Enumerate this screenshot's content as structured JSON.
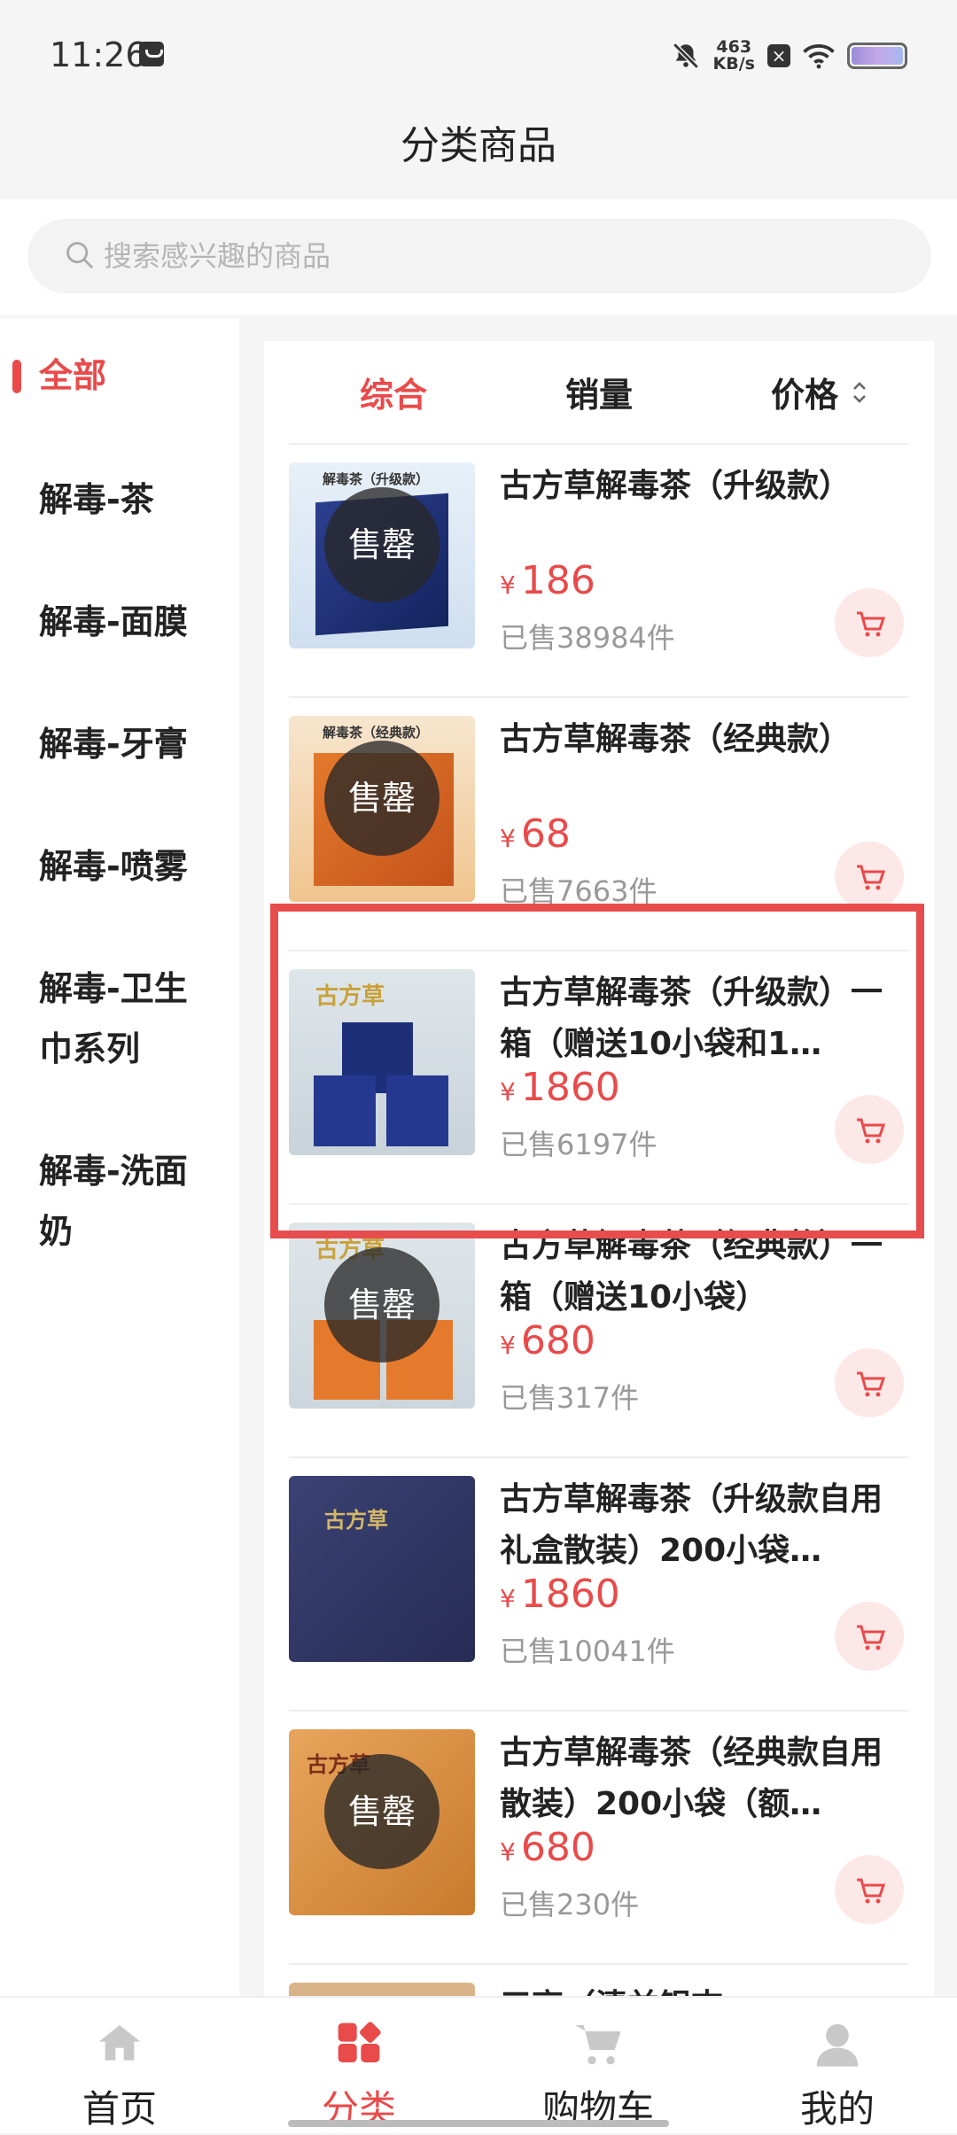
{
  "status": {
    "time": "11:26",
    "speed_value": "463",
    "speed_unit": "KB/s"
  },
  "page": {
    "title": "分类商品"
  },
  "search": {
    "placeholder": "搜索感兴趣的商品"
  },
  "sidebar": {
    "items": [
      {
        "label": "全部",
        "active": true
      },
      {
        "label": "解毒-茶"
      },
      {
        "label": "解毒-面膜"
      },
      {
        "label": "解毒-牙膏"
      },
      {
        "label": "解毒-喷雾"
      },
      {
        "label": "解毒-卫生巾系列"
      },
      {
        "label": "解毒-洗面奶"
      }
    ]
  },
  "sort": {
    "tabs": [
      {
        "label": "综合",
        "active": true
      },
      {
        "label": "销量"
      },
      {
        "label": "价格"
      }
    ]
  },
  "soldout_label": "售罄",
  "currency": "¥",
  "products": [
    {
      "title": "古方草解毒茶（升级款）",
      "price": "186",
      "sold": "已售38984件",
      "soldout": true,
      "thumb_label": "解毒茶（升级款）"
    },
    {
      "title": "古方草解毒茶（经典款）",
      "price": "68",
      "sold": "已售7663件",
      "soldout": true,
      "thumb_label": "解毒茶（经典款）"
    },
    {
      "title": "古方草解毒茶（升级款）一箱（赠送10小袋和1…",
      "price": "1860",
      "sold": "已售6197件",
      "soldout": false,
      "thumb_label": "古方草"
    },
    {
      "title": "古方草解毒茶（经典款）一箱（赠送10小袋）",
      "price": "680",
      "sold": "已售317件",
      "soldout": true,
      "thumb_label": "古方草"
    },
    {
      "title": "古方草解毒茶（升级款自用礼盒散装）200小袋…",
      "price": "1860",
      "sold": "已售10041件",
      "soldout": false,
      "thumb_label": "古方草"
    },
    {
      "title": "古方草解毒茶（经典款自用散装）200小袋（额…",
      "price": "680",
      "sold": "已售230件",
      "soldout": true,
      "thumb_label": "古方草"
    },
    {
      "title": "三高（清益银杏",
      "price": "",
      "sold": "",
      "soldout": false,
      "thumb_label": ""
    }
  ],
  "bottom_nav": [
    {
      "label": "首页",
      "icon": "home-icon"
    },
    {
      "label": "分类",
      "icon": "category-icon",
      "active": true
    },
    {
      "label": "购物车",
      "icon": "cart-icon"
    },
    {
      "label": "我的",
      "icon": "profile-icon"
    }
  ],
  "colors": {
    "accent": "#e94a4a",
    "highlight": "#e84d4d"
  }
}
